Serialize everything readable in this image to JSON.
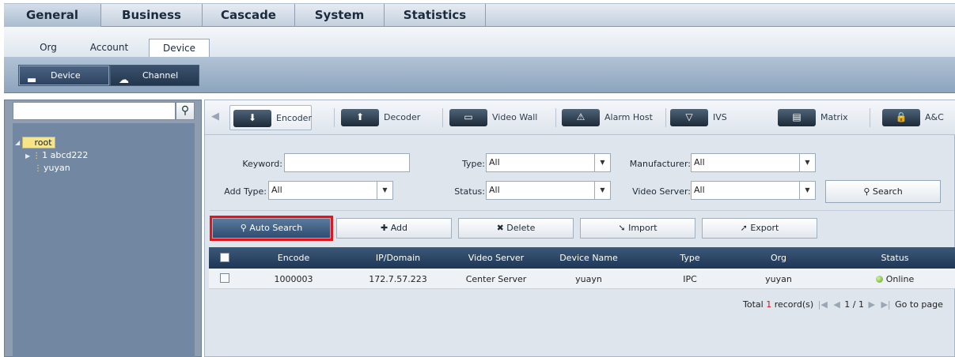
{
  "main_tabs": [
    "General",
    "Business",
    "Cascade",
    "System",
    "Statistics"
  ],
  "sub_tabs": [
    "Org",
    "Account",
    "Device"
  ],
  "mode_buttons": [
    "Device",
    "Channel"
  ],
  "tree": {
    "search_placeholder": "",
    "nodes": [
      {
        "label": "root"
      },
      {
        "label": "1 abcd222"
      },
      {
        "label": "yuyan"
      }
    ]
  },
  "categories": [
    "Encoder",
    "Decoder",
    "Video Wall",
    "Alarm Host",
    "IVS",
    "Matrix",
    "A&C"
  ],
  "filters": {
    "keyword_label": "Keyword:",
    "keyword_value": "",
    "type_label": "Type:",
    "type_value": "All",
    "manufacturer_label": "Manufacturer:",
    "manufacturer_value": "All",
    "add_type_label": "Add Type:",
    "add_type_value": "All",
    "status_label": "Status:",
    "status_value": "All",
    "video_server_label": "Video Server:",
    "video_server_value": "All",
    "search_label": "Search"
  },
  "toolbar": {
    "auto_search": "Auto Search",
    "add": "Add",
    "delete": "Delete",
    "import": "Import",
    "export": "Export"
  },
  "table": {
    "columns": [
      "Encode",
      "IP/Domain",
      "Video Server",
      "Device Name",
      "Type",
      "Org",
      "Status"
    ],
    "rows": [
      {
        "encode": "1000003",
        "ip": "172.7.57.223",
        "server": "Center Server",
        "name": "yuayn",
        "type": "IPC",
        "org": "yuyan",
        "status": "Online"
      }
    ]
  },
  "pager": {
    "total_label": "Total",
    "count": "1",
    "records_label": "record(s)",
    "page": "1 / 1",
    "goto_label": "Go to page"
  },
  "colors": {
    "highlight_border": "#e3141b",
    "online": "#5aa816"
  }
}
